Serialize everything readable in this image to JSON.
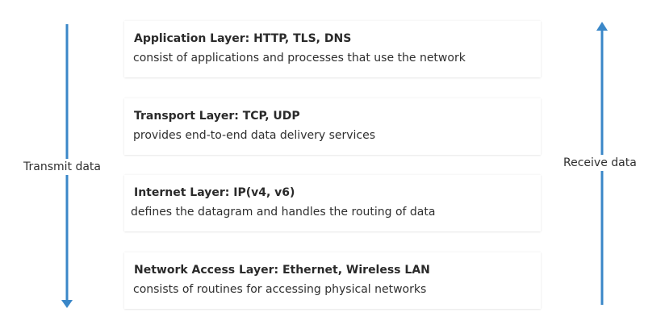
{
  "layers": [
    {
      "title": "Application Layer: HTTP, TLS, DNS",
      "description": "consist of applications and processes that use the network"
    },
    {
      "title": "Transport Layer: TCP, UDP",
      "description": "provides end-to-end data delivery services"
    },
    {
      "title": "Internet Layer: IP(v4, v6)",
      "description": "defines the datagram and handles the routing of data"
    },
    {
      "title": "Network Access Layer: Ethernet, Wireless LAN",
      "description": "consists of routines for accessing physical networks"
    }
  ],
  "arrows": {
    "left_label": "Transmit data",
    "right_label": "Receive data",
    "color": "#3a87c8"
  }
}
